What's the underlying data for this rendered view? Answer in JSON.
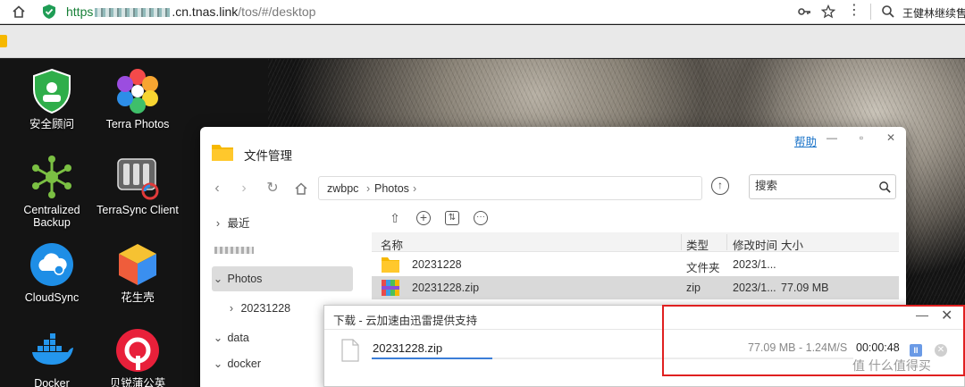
{
  "browser": {
    "url_proto": "https",
    "url_host_suffix": ".cn.tnas.link",
    "url_path": "/tos/#/desktop",
    "search_text": "王健林继续售卖"
  },
  "desktop": {
    "apps": [
      {
        "label": "安全顾问"
      },
      {
        "label": "Terra Photos"
      },
      {
        "label": "Centralized Backup"
      },
      {
        "label": "TerraSync Client"
      },
      {
        "label": "CloudSync"
      },
      {
        "label": "花生壳"
      },
      {
        "label": "Docker"
      },
      {
        "label": "贝锐蒲公英"
      }
    ]
  },
  "file_manager": {
    "title": "文件管理",
    "help": "帮助",
    "breadcrumb": [
      "zwbpc",
      "Photos"
    ],
    "search_placeholder": "搜索",
    "sidebar": [
      {
        "label": "最近",
        "caret": "›"
      },
      {
        "label": "Photos",
        "caret": "⌄"
      },
      {
        "label": "20231228",
        "caret": "›"
      },
      {
        "label": "data",
        "caret": "⌄"
      },
      {
        "label": "docker",
        "caret": "⌄"
      }
    ],
    "columns": [
      "名称",
      "类型",
      "修改时间",
      "大小"
    ],
    "rows": [
      {
        "name": "20231228",
        "type": "文件夹",
        "modified": "2023/1...",
        "size": "",
        "icon": "folder-icon",
        "selected": false
      },
      {
        "name": "20231228.zip",
        "type": "zip",
        "modified": "2023/1...",
        "size": "77.09 MB",
        "icon": "zip-icon",
        "selected": true
      }
    ]
  },
  "download": {
    "title": "下载 - 云加速由迅雷提供支持",
    "file_name": "20231228.zip",
    "stats": "77.09 MB - 1.24M/S",
    "eta": "00:00:48",
    "progress": 0.25
  },
  "watermark": "值 什么值得买",
  "colors": {
    "accent": "#3b7ed8",
    "highlight_box": "#e02020",
    "url_proto": "#188038",
    "folder": "#f6b800"
  }
}
